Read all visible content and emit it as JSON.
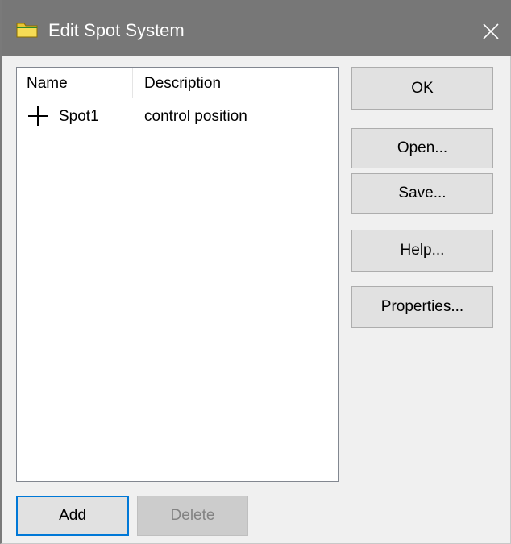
{
  "window": {
    "title": "Edit Spot System",
    "close_icon": "close-icon",
    "folder_icon": "folder-icon"
  },
  "list": {
    "columns": [
      "Name",
      "Description"
    ],
    "rows": [
      {
        "icon": "crosshair-icon",
        "name": "Spot1",
        "description": "control position"
      }
    ]
  },
  "buttons": {
    "ok": "OK",
    "open": "Open...",
    "save": "Save...",
    "help": "Help...",
    "properties": "Properties...",
    "add": "Add",
    "delete": "Delete"
  },
  "colors": {
    "titlebar": "#777777",
    "default_button_border": "#0078d7",
    "folder": "#f2d43c"
  }
}
